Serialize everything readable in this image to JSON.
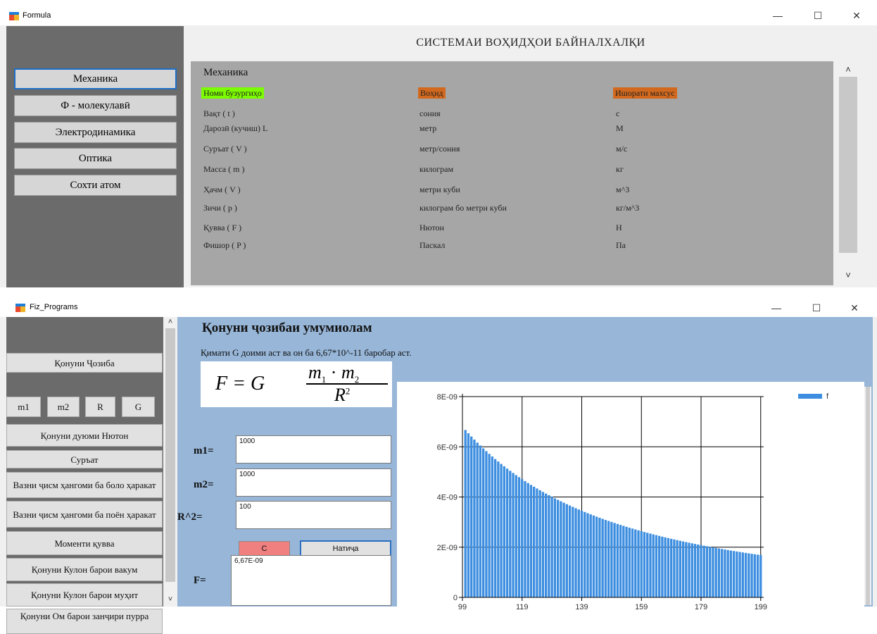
{
  "formula_window": {
    "title": "Formula",
    "controls": {
      "minimize": "—",
      "maximize": "☐",
      "close": "✕"
    },
    "heading": "СИСТЕМАИ ВОҲИДҲОИ БАЙНАЛХАЛҚИ",
    "nav": [
      "Механика",
      "Ф - молекулавӣ",
      "Электродинамика",
      "Оптика",
      "Сохти атом"
    ],
    "active_nav": "Механика",
    "panel": {
      "title": "Механика",
      "headers": [
        {
          "text": "Номи бузургиҳо",
          "color": "#7cfc00"
        },
        {
          "text": "Воҳид",
          "color": "#d2691e"
        },
        {
          "text": "Ишорати махсус",
          "color": "#d2691e"
        }
      ],
      "rows": [
        {
          "name": "Вақт ( t )",
          "unit": "сония",
          "symbol": "с"
        },
        {
          "name": "Дарозӣ (кучиш) L",
          "unit": "метр",
          "symbol": "М"
        },
        {
          "name": "Суръат ( V )",
          "unit": "метр/сония",
          "symbol": "м/с"
        },
        {
          "name": "Масса ( m )",
          "unit": "килограм",
          "symbol": "кг"
        },
        {
          "name": "Ҳачм ( V )",
          "unit": "метри куби",
          "symbol": "м^3"
        },
        {
          "name": "Зичи ( р )",
          "unit": "килограм бо метри куби",
          "symbol": "кг/м^3"
        },
        {
          "name": "Қувва ( F )",
          "unit": "Нютон",
          "symbol": "Н"
        },
        {
          "name": "Фишор ( P )",
          "unit": "Паскал",
          "symbol": "Па"
        }
      ]
    },
    "scroll": {
      "up": "˄",
      "down": "˅"
    }
  },
  "fiz_window": {
    "title": "Fiz_Programs",
    "controls": {
      "minimize": "—",
      "maximize": "☐",
      "close": "✕"
    },
    "sidebar": {
      "top_button": "Қонуни Ҷозиба",
      "small_buttons": [
        "m1",
        "m2",
        "R",
        "G"
      ],
      "buttons": [
        "Қонуни дуюми Нютон",
        "Суръат",
        "Вазни ҷисм ҳангоми ба боло ҳаракат",
        "Вазни ҷисм ҳангоми ба поён ҳаракат",
        "Моменти қувва",
        "Қонуни Кулон барои вакум",
        "Қонуни Кулон барои муҳит",
        "Қонуни Ом барои занҷири пурра"
      ],
      "scroll_up": "˄",
      "scroll_down": "˅"
    },
    "main": {
      "title": "Қонуни ҷозибаи умумиолам",
      "info": "Қимати G доими аст ва он ба  6,67*10^-11 баробар аст.",
      "formula": {
        "lhs": "F = G",
        "numerator_a": "m",
        "sub_a": "1",
        "dot": " · ",
        "numerator_b": "m",
        "sub_b": "2",
        "denominator": "R",
        "sup": "2"
      },
      "fields": [
        {
          "label": "m1=",
          "value": "1000"
        },
        {
          "label": "m2=",
          "value": "1000"
        },
        {
          "label": "R^2=",
          "value": "100"
        }
      ],
      "clear_button": "C",
      "result_button": "Натиҷа",
      "result_label": "F=",
      "result_value": "6,67E-09"
    }
  },
  "chart_data": {
    "type": "bar",
    "title": "",
    "xlabel": "",
    "ylabel": "",
    "legend": [
      "f"
    ],
    "legend_position": "top-right",
    "grid": true,
    "color": "#3d8ee0",
    "x_ticks": [
      99,
      119,
      139,
      159,
      179,
      199
    ],
    "y_ticks": [
      "0",
      "2E-09",
      "4E-09",
      "6E-09",
      "8E-09"
    ],
    "xlim": [
      99,
      200
    ],
    "ylim": [
      0,
      8e-09
    ],
    "series": [
      {
        "name": "f",
        "x_start": 100,
        "x_end": 199,
        "formula": "6.67E-11 * 1000 * 1000 / x^2",
        "values_sample": {
          "100": 6.67e-09,
          "119": 4.71e-09,
          "139": 3.45e-09,
          "159": 2.64e-09,
          "179": 2.08e-09,
          "199": 1.68e-09
        }
      }
    ]
  }
}
